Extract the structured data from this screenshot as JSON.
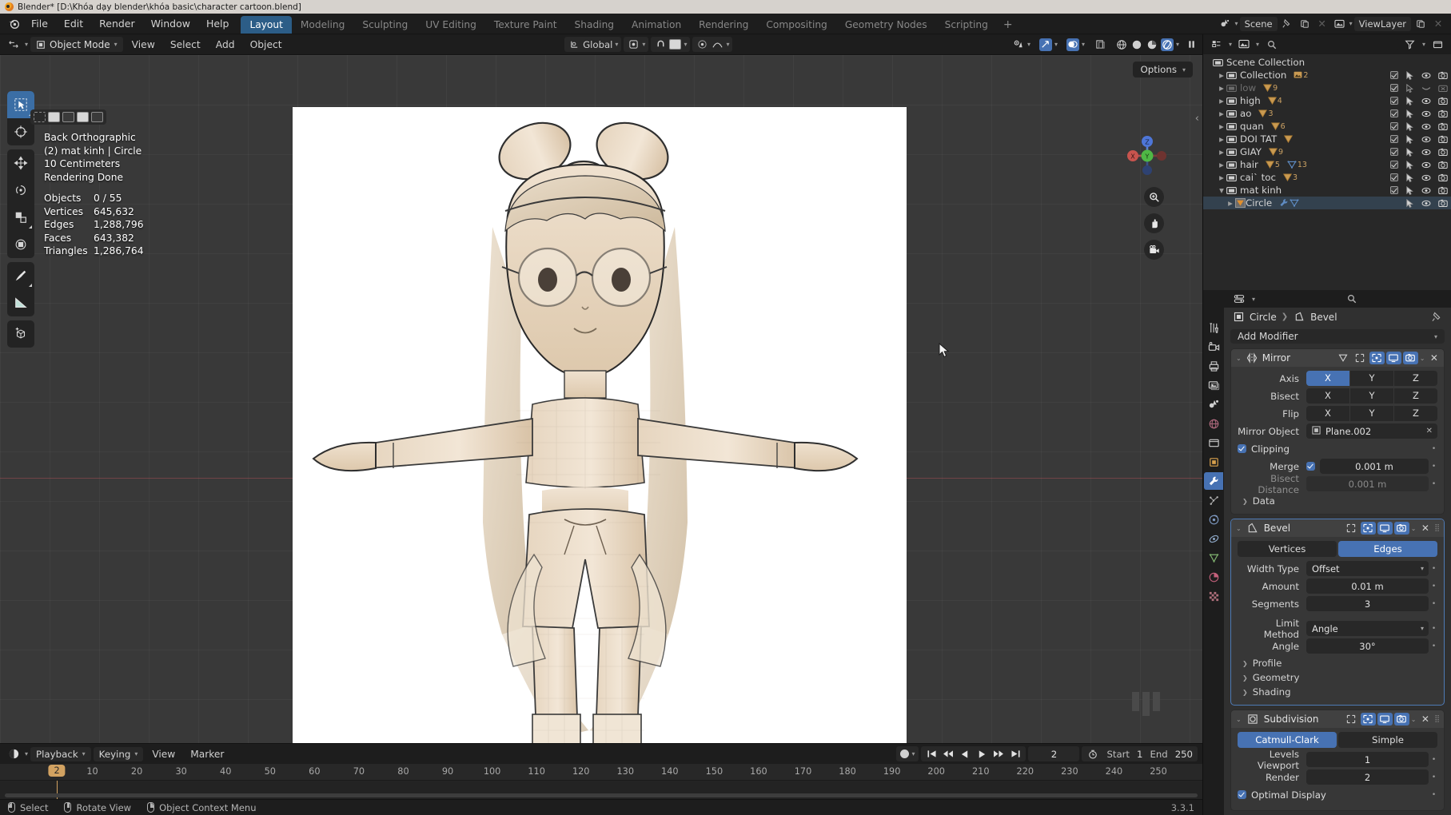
{
  "window": {
    "title": "Blender* [D:\\Khóa dạy blender\\khóa basic\\character cartoon.blend]"
  },
  "topbar": {
    "menus": [
      "File",
      "Edit",
      "Render",
      "Window",
      "Help"
    ],
    "workspaces": [
      {
        "label": "Layout",
        "active": true
      },
      {
        "label": "Modeling",
        "active": false
      },
      {
        "label": "Sculpting",
        "active": false
      },
      {
        "label": "UV Editing",
        "active": false
      },
      {
        "label": "Texture Paint",
        "active": false
      },
      {
        "label": "Shading",
        "active": false
      },
      {
        "label": "Animation",
        "active": false
      },
      {
        "label": "Rendering",
        "active": false
      },
      {
        "label": "Compositing",
        "active": false
      },
      {
        "label": "Geometry Nodes",
        "active": false
      },
      {
        "label": "Scripting",
        "active": false
      }
    ],
    "add_workspace": "+",
    "scene_name": "Scene",
    "viewlayer_name": "ViewLayer"
  },
  "viewport_header": {
    "mode": "Object Mode",
    "menus": [
      "View",
      "Select",
      "Add",
      "Object"
    ],
    "transform_orientation": "Global"
  },
  "viewport": {
    "options_label": "Options",
    "overlay_lines": [
      "Back Orthographic",
      "(2) mat kinh | Circle",
      "10 Centimeters",
      "Rendering Done"
    ],
    "stats": [
      {
        "key": "Objects",
        "value": "0 / 55"
      },
      {
        "key": "Vertices",
        "value": "645,632"
      },
      {
        "key": "Edges",
        "value": "1,288,796"
      },
      {
        "key": "Faces",
        "value": "643,382"
      },
      {
        "key": "Triangles",
        "value": "1,286,764"
      }
    ],
    "gizmo_axes": [
      "X",
      "Y",
      "Z"
    ]
  },
  "outliner": {
    "root": "Scene Collection",
    "items": [
      {
        "name": "Collection",
        "badge": "2",
        "badge_type": "image",
        "dim": false,
        "expanded": false,
        "indent": 1,
        "checkbox": true,
        "cursor": "on",
        "eye": "on",
        "camera": "on"
      },
      {
        "name": "low",
        "badge": "9",
        "badge_type": "mesh",
        "dim": true,
        "expanded": false,
        "indent": 1,
        "checkbox": true,
        "cursor": "off",
        "eye": "closed",
        "camera": "off"
      },
      {
        "name": "high",
        "badge": "4",
        "badge_type": "mesh",
        "dim": false,
        "expanded": false,
        "indent": 1,
        "checkbox": true,
        "cursor": "on",
        "eye": "on",
        "camera": "on"
      },
      {
        "name": "ao",
        "badge": "3",
        "badge_type": "mesh",
        "dim": false,
        "expanded": false,
        "indent": 1,
        "checkbox": true,
        "cursor": "on",
        "eye": "on",
        "camera": "on"
      },
      {
        "name": "quan",
        "badge": "6",
        "badge_type": "mesh",
        "dim": false,
        "expanded": false,
        "indent": 1,
        "checkbox": true,
        "cursor": "on",
        "eye": "on",
        "camera": "on"
      },
      {
        "name": "DOI TAT",
        "badge": "",
        "badge_type": "mesh",
        "dim": false,
        "expanded": false,
        "indent": 1,
        "checkbox": true,
        "cursor": "on",
        "eye": "on",
        "camera": "on"
      },
      {
        "name": "GIAY",
        "badge": "9",
        "badge_type": "mesh",
        "dim": false,
        "expanded": false,
        "indent": 1,
        "checkbox": true,
        "cursor": "on",
        "eye": "on",
        "camera": "on"
      },
      {
        "name": "hair",
        "badge": "5",
        "badge2": "13",
        "badge_type": "mesh",
        "dim": false,
        "expanded": false,
        "indent": 1,
        "checkbox": true,
        "cursor": "on",
        "eye": "on",
        "camera": "on"
      },
      {
        "name": "cai` toc",
        "badge": "3",
        "badge_type": "mesh",
        "dim": false,
        "expanded": false,
        "indent": 1,
        "checkbox": true,
        "cursor": "on",
        "eye": "on",
        "camera": "on"
      },
      {
        "name": "mat kinh",
        "badge": "",
        "badge_type": "none",
        "dim": false,
        "expanded": true,
        "indent": 1,
        "checkbox": true,
        "cursor": "on",
        "eye": "on",
        "camera": "on"
      },
      {
        "name": "Circle",
        "badge": "",
        "badge_type": "object",
        "dim": false,
        "expanded": false,
        "indent": 2,
        "checkbox": false,
        "cursor": "on",
        "eye": "on",
        "camera": "on",
        "selected": true
      }
    ]
  },
  "properties": {
    "breadcrumb": {
      "object": "Circle",
      "modifier": "Bevel"
    },
    "add_modifier_label": "Add Modifier",
    "modifiers": [
      {
        "name": "Mirror",
        "type": "mirror",
        "rows": [
          {
            "label": "Axis",
            "kind": "seg",
            "options": [
              "X",
              "Y",
              "Z"
            ],
            "active": "X"
          },
          {
            "label": "Bisect",
            "kind": "seg",
            "options": [
              "X",
              "Y",
              "Z"
            ],
            "active": ""
          },
          {
            "label": "Flip",
            "kind": "seg",
            "options": [
              "X",
              "Y",
              "Z"
            ],
            "active": ""
          },
          {
            "label": "Mirror Object",
            "kind": "object",
            "value": "Plane.002"
          },
          {
            "label": "",
            "kind": "check",
            "value": "Clipping",
            "checked": true
          },
          {
            "label": "Merge",
            "kind": "check-field",
            "value": "0.001 m",
            "checked": true
          },
          {
            "label": "Bisect Distance",
            "kind": "field-dim",
            "value": "0.001 m"
          }
        ],
        "subpanels": [
          "Data"
        ]
      },
      {
        "name": "Bevel",
        "type": "bevel",
        "selected": true,
        "vseg": {
          "options": [
            "Vertices",
            "Edges"
          ],
          "active": "Edges"
        },
        "rows": [
          {
            "label": "Width Type",
            "kind": "dropdown",
            "value": "Offset"
          },
          {
            "label": "Amount",
            "kind": "field",
            "value": "0.01 m"
          },
          {
            "label": "Segments",
            "kind": "field",
            "value": "3"
          },
          {
            "label": "",
            "kind": "gap"
          },
          {
            "label": "Limit Method",
            "kind": "dropdown",
            "value": "Angle"
          },
          {
            "label": "Angle",
            "kind": "field",
            "value": "30°"
          }
        ],
        "subpanels": [
          "Profile",
          "Geometry",
          "Shading"
        ]
      },
      {
        "name": "Subdivision",
        "type": "subsurf",
        "vseg": {
          "options": [
            "Catmull-Clark",
            "Simple"
          ],
          "active": "Catmull-Clark"
        },
        "rows": [
          {
            "label": "Levels Viewport",
            "kind": "field",
            "value": "1"
          },
          {
            "label": "Render",
            "kind": "field",
            "value": "2"
          },
          {
            "label": "",
            "kind": "check",
            "value": "Optimal Display",
            "checked": true
          }
        ],
        "subpanels": []
      }
    ]
  },
  "timeline": {
    "playback_label": "Playback",
    "keying_label": "Keying",
    "menus": [
      "View",
      "Marker"
    ],
    "current_frame": "2",
    "start_label": "Start",
    "start_value": "1",
    "end_label": "End",
    "end_value": "250",
    "ticks": [
      "10",
      "20",
      "30",
      "40",
      "50",
      "60",
      "70",
      "80",
      "90",
      "100",
      "110",
      "120",
      "130",
      "140",
      "150",
      "160",
      "170",
      "180",
      "190",
      "200",
      "210",
      "220",
      "230",
      "240",
      "250"
    ],
    "playhead_frame": "2"
  },
  "statusbar": {
    "items": [
      {
        "mouse": "left",
        "label": "Select"
      },
      {
        "mouse": "middle",
        "label": "Rotate View"
      },
      {
        "mouse": "right",
        "label": "Object Context Menu"
      }
    ],
    "version": "3.3.1"
  },
  "colors": {
    "accent": "#4772b3",
    "panel": "#303030",
    "field": "#282828",
    "viewport_bg": "#393939",
    "playhead": "#d2a261"
  }
}
